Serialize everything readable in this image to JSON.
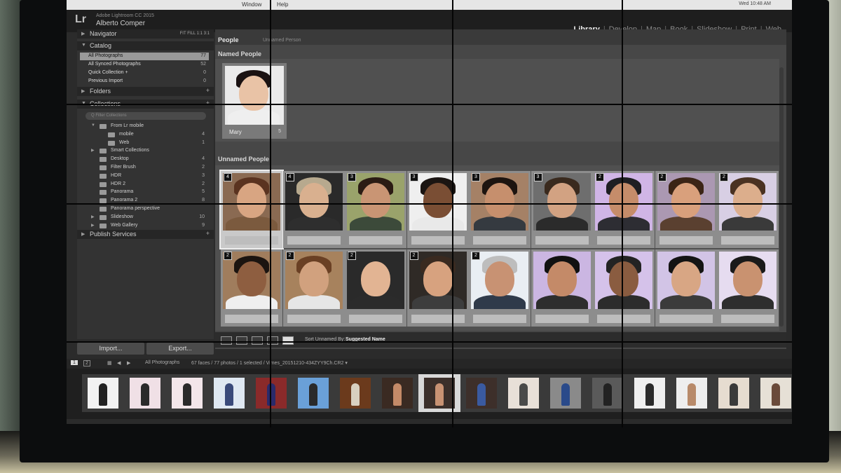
{
  "menubar": {
    "items": [
      "",
      "",
      "",
      "Window",
      "Help"
    ],
    "status": "Wed 10:48 AM"
  },
  "identity": {
    "logo": "Lr",
    "app_version": "Adobe Lightroom CC 2015",
    "user": "Alberto Comper",
    "modules": [
      "Library",
      "Develop",
      "Map",
      "Book",
      "Slideshow",
      "Print",
      "Web"
    ],
    "active_module": "Library"
  },
  "left_panel": {
    "navigator": {
      "label": "Navigator",
      "zoom": "FIT FILL 1:1 3:1"
    },
    "catalog": {
      "label": "Catalog",
      "items": [
        {
          "name": "All Photographs",
          "count": "77"
        },
        {
          "name": "All Synced Photographs",
          "count": "52"
        },
        {
          "name": "Quick Collection +",
          "count": "0"
        },
        {
          "name": "Previous Import",
          "count": "0"
        }
      ]
    },
    "folders": {
      "label": "Folders"
    },
    "collections": {
      "label": "Collections",
      "filter_placeholder": "Q Filter Collections",
      "items": [
        {
          "name": "From Lr mobile",
          "count": "",
          "indent": 0,
          "exp": "▼"
        },
        {
          "name": "mobile",
          "count": "4",
          "indent": 1,
          "exp": ""
        },
        {
          "name": "Web",
          "count": "1",
          "indent": 1,
          "exp": ""
        },
        {
          "name": "Smart Collections",
          "count": "",
          "indent": 0,
          "exp": "▶"
        },
        {
          "name": "Desktop",
          "count": "4",
          "indent": 0,
          "exp": ""
        },
        {
          "name": "Filter Brush",
          "count": "2",
          "indent": 0,
          "exp": ""
        },
        {
          "name": "HDR",
          "count": "3",
          "indent": 0,
          "exp": ""
        },
        {
          "name": "HDR 2",
          "count": "2",
          "indent": 0,
          "exp": ""
        },
        {
          "name": "Panorama",
          "count": "5",
          "indent": 0,
          "exp": ""
        },
        {
          "name": "Panorama 2",
          "count": "8",
          "indent": 0,
          "exp": ""
        },
        {
          "name": "Panorama perspective",
          "count": "",
          "indent": 0,
          "exp": ""
        },
        {
          "name": "Slideshow",
          "count": "10",
          "indent": 0,
          "exp": "▶"
        },
        {
          "name": "Web Gallery",
          "count": "9",
          "indent": 0,
          "exp": "▶"
        }
      ]
    },
    "publish": {
      "label": "Publish Services"
    },
    "import_label": "Import...",
    "export_label": "Export..."
  },
  "people_view": {
    "tab_people": "People",
    "tab_unnamed": "Unnamed Person",
    "named_heading": "Named People",
    "unnamed_heading": "Unnamed People",
    "named": [
      {
        "name": "Mary",
        "count": "5",
        "skin": "#e9c3a6",
        "hair": "#1a1212",
        "shirt": "#efefef",
        "bg": "#eaeaea"
      }
    ],
    "unnamed": [
      {
        "count": "4",
        "label": "",
        "skin": "#d8a582",
        "hair": "#5a3320",
        "shirt": "#7b5a3e",
        "bg": "#8a6a52",
        "sel": true
      },
      {
        "count": "4",
        "label": "",
        "skin": "#d9b08f",
        "hair": "#b7a98e",
        "shirt": "#2e2e2e",
        "bg": "#2a2a2a",
        "sel": false
      },
      {
        "count": "3",
        "label": "",
        "skin": "#c99574",
        "hair": "#2b1c14",
        "shirt": "#3c4a3a",
        "bg": "#9aa36b",
        "sel": false
      },
      {
        "count": "3",
        "label": "",
        "skin": "#7a4e34",
        "hair": "#1b1512",
        "shirt": "#e9e9e9",
        "bg": "#efefef",
        "sel": false
      },
      {
        "count": "3",
        "label": "",
        "skin": "#c68f6d",
        "hair": "#1d1410",
        "shirt": "#353a40",
        "bg": "#a58166",
        "sel": false
      },
      {
        "count": "3",
        "label": "",
        "skin": "#d2a282",
        "hair": "#3a2a1e",
        "shirt": "#2b2b2b",
        "bg": "#6e6e6e",
        "sel": false
      },
      {
        "count": "2",
        "label": "",
        "skin": "#c58c6a",
        "hair": "#1e1e22",
        "shirt": "#2d2d33",
        "bg": "#d0b5e6",
        "sel": false
      },
      {
        "count": "2",
        "label": "",
        "skin": "#d9a07c",
        "hair": "#3b2416",
        "shirt": "#5a4030",
        "bg": "#ab98b2",
        "sel": false
      },
      {
        "count": "2",
        "label": "",
        "skin": "#dcae8c",
        "hair": "#4a3222",
        "shirt": "#3a3a3a",
        "bg": "#d8cfe4",
        "sel": false
      },
      {
        "count": "2",
        "label": "",
        "skin": "#8e5e40",
        "hair": "#1b1410",
        "shirt": "#efefef",
        "bg": "#a07d5d",
        "sel": false
      },
      {
        "count": "2",
        "label": "",
        "skin": "#d1a17e",
        "hair": "#6a4024",
        "shirt": "#e6e6e6",
        "bg": "#a7825d",
        "sel": false
      },
      {
        "count": "2",
        "label": "",
        "skin": "#e2b493",
        "hair": "#2a2a2a",
        "shirt": "#2b2b2b",
        "bg": "#2a2a2a",
        "sel": false
      },
      {
        "count": "2",
        "label": "",
        "skin": "#d7a27f",
        "hair": "#3a2a20",
        "shirt": "#3d3d3d",
        "bg": "#2f2a26",
        "sel": false
      },
      {
        "count": "2",
        "label": "",
        "skin": "#c89273",
        "hair": "#bdbdbd",
        "shirt": "#2f3a4a",
        "bg": "#e9eef3",
        "sel": false
      },
      {
        "count": "",
        "label": "",
        "skin": "#c48a68",
        "hair": "#111111",
        "shirt": "#2d2d2d",
        "bg": "#cbb6e2",
        "sel": false
      },
      {
        "count": "",
        "label": "",
        "skin": "#8a5c40",
        "hair": "#232323",
        "shirt": "#2c2c2c",
        "bg": "#d5c2ea",
        "sel": false
      },
      {
        "count": "",
        "label": "",
        "skin": "#d8a684",
        "hair": "#141414",
        "shirt": "#3b3b3b",
        "bg": "#d2c4e6",
        "sel": false
      },
      {
        "count": "",
        "label": "",
        "skin": "#c99270",
        "hair": "#1a1a1a",
        "shirt": "#2e2e2e",
        "bg": "#e6dcf0",
        "sel": false
      }
    ],
    "sort_label": "Sort Unnamed By:",
    "sort_value": "Suggested Name"
  },
  "filmstrip": {
    "pages": [
      "1",
      "2"
    ],
    "source": "All Photographs",
    "info": "67 faces / 77 photos / 1 selected / Vimes_20151210-434ZYY9Ch.CR2 ▾",
    "thumbs": [
      {
        "bg": "#f2f2f2",
        "fg": "#222222",
        "sel": false
      },
      {
        "bg": "#f0e0e6",
        "fg": "#2a2a2a",
        "sel": false
      },
      {
        "bg": "#f3e6ea",
        "fg": "#2a2a2a",
        "sel": false
      },
      {
        "bg": "#dfe8f2",
        "fg": "#3a4a7a",
        "sel": false
      },
      {
        "bg": "#8a2a2a",
        "fg": "#2a2a6a",
        "sel": false
      },
      {
        "bg": "#6aa0d8",
        "fg": "#2a2a2a",
        "sel": false
      },
      {
        "bg": "#6b3a1c",
        "fg": "#d8d0c0",
        "sel": false
      },
      {
        "bg": "#3a2a22",
        "fg": "#c48a68",
        "sel": false
      },
      {
        "bg": "#3b2f2a",
        "fg": "#c89273",
        "sel": true
      },
      {
        "bg": "#3d2f2a",
        "fg": "#3a5aa0",
        "sel": false
      },
      {
        "bg": "#e8e0d8",
        "fg": "#4a4a4a",
        "sel": false
      },
      {
        "bg": "#8a8a8a",
        "fg": "#2a4a8a",
        "sel": false
      },
      {
        "bg": "#5a5a5a",
        "fg": "#222222",
        "sel": false
      },
      {
        "bg": "#efefef",
        "fg": "#2a2a2a",
        "sel": false
      },
      {
        "bg": "#eeeeee",
        "fg": "#b88a6a",
        "sel": false
      },
      {
        "bg": "#e6dcd0",
        "fg": "#3a3a3a",
        "sel": false
      },
      {
        "bg": "#e6e0d6",
        "fg": "#6a4a3a",
        "sel": false
      }
    ]
  }
}
